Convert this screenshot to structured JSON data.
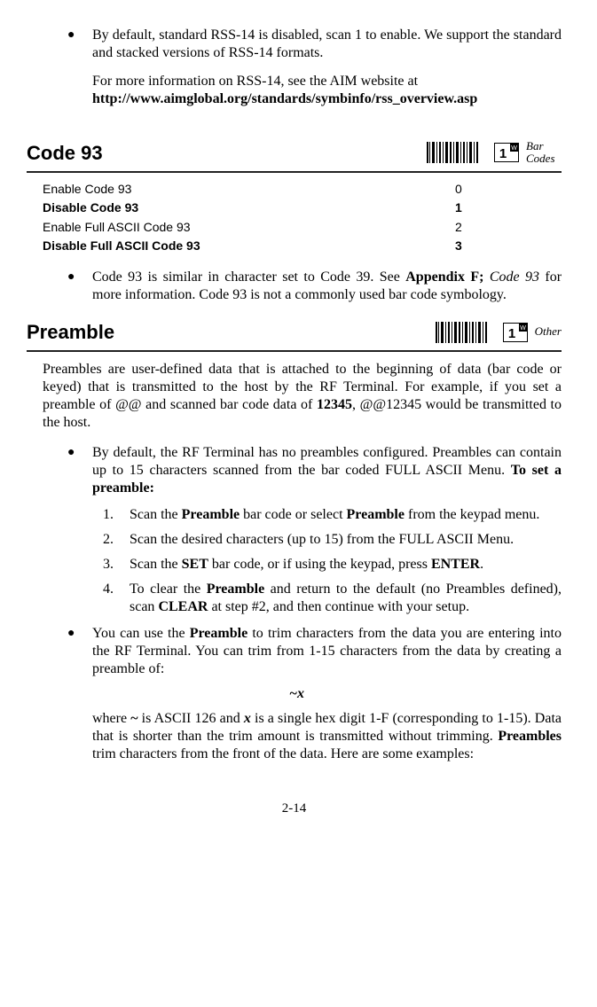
{
  "intro": {
    "bullet1": "By default, standard RSS-14 is disabled, scan 1 to enable. We support the standard and stacked versions of RSS-14 formats.",
    "moreinfo_prefix": "For more information on RSS-14, see the AIM website at",
    "moreinfo_url": "http://www.aimglobal.org/standards/symbinfo/rss_overview.asp"
  },
  "code93": {
    "heading": "Code 93",
    "badge_caption": "Bar Codes",
    "rows": [
      {
        "label": "Enable Code 93",
        "value": "0",
        "bold": false
      },
      {
        "label": "Disable Code 93",
        "value": "1",
        "bold": true
      },
      {
        "label": "Enable Full ASCII Code 93",
        "value": "2",
        "bold": false
      },
      {
        "label": "Disable Full ASCII Code 93",
        "value": "3",
        "bold": true
      }
    ],
    "bullet_preA": "Code 93 is similar in character set to Code 39.  See ",
    "bullet_apx_bold": "Appendix F;",
    "bullet_apx_ital": " Code 93",
    "bullet_postA": " for more information.  Code 93 is not a commonly used bar code symbology."
  },
  "preamble": {
    "heading": "Preamble",
    "badge_caption": "Other",
    "intro_a": "Preambles are user-defined data that is attached to the beginning of data (bar code or keyed) that is transmitted to the host by the RF Terminal. For example, if you set a preamble of ",
    "intro_at1": "@@",
    "intro_b": " and scanned bar code data of ",
    "intro_num": "12345",
    "intro_c": ", ",
    "intro_at2": "@@12345",
    "intro_d": " would be transmitted to the host.",
    "bullet1_a": "By default, the RF Terminal has no preambles configured.  Preambles can contain up to 15 characters scanned from the bar coded FULL ASCII Menu. ",
    "bullet1_bold": "To set a preamble:",
    "steps": [
      {
        "num": "1.",
        "pre": "Scan the ",
        "b1": "Preamble",
        "mid": " bar code or select ",
        "b2": "Preamble",
        "post": " from the keypad menu."
      },
      {
        "num": "2.",
        "text": "Scan the desired characters (up to 15) from the FULL ASCII Menu."
      },
      {
        "num": "3.",
        "pre": "Scan the ",
        "b1": "SET",
        "mid": " bar code, or if using the keypad, press ",
        "b2": "ENTER",
        "post": "."
      },
      {
        "num": "4.",
        "pre": "To clear the ",
        "b1": "Preamble",
        "mid": " and return to the default (no Preambles defined), scan ",
        "b2": "CLEAR",
        "post": " at step #2, and then continue with your setup."
      }
    ],
    "bullet2_a": "You can use the ",
    "bullet2_bold": "Preamble",
    "bullet2_b": " to trim characters from the data you are entering into the RF Terminal. You can trim from 1-15 characters from the data by creating a preamble of:",
    "tilde_expr": "~x",
    "trim_a": "where ",
    "trim_tilde": "~",
    "trim_b": " is ASCII 126 and ",
    "trim_x": "x",
    "trim_c": " is a single hex digit 1-F (corresponding to 1-15).  Data that is shorter than the trim amount is transmitted without trimming.  ",
    "trim_bold": "Preambles",
    "trim_d": " trim characters from the front of the data. Here are some examples:"
  },
  "page_number": "2-14",
  "one": "1"
}
